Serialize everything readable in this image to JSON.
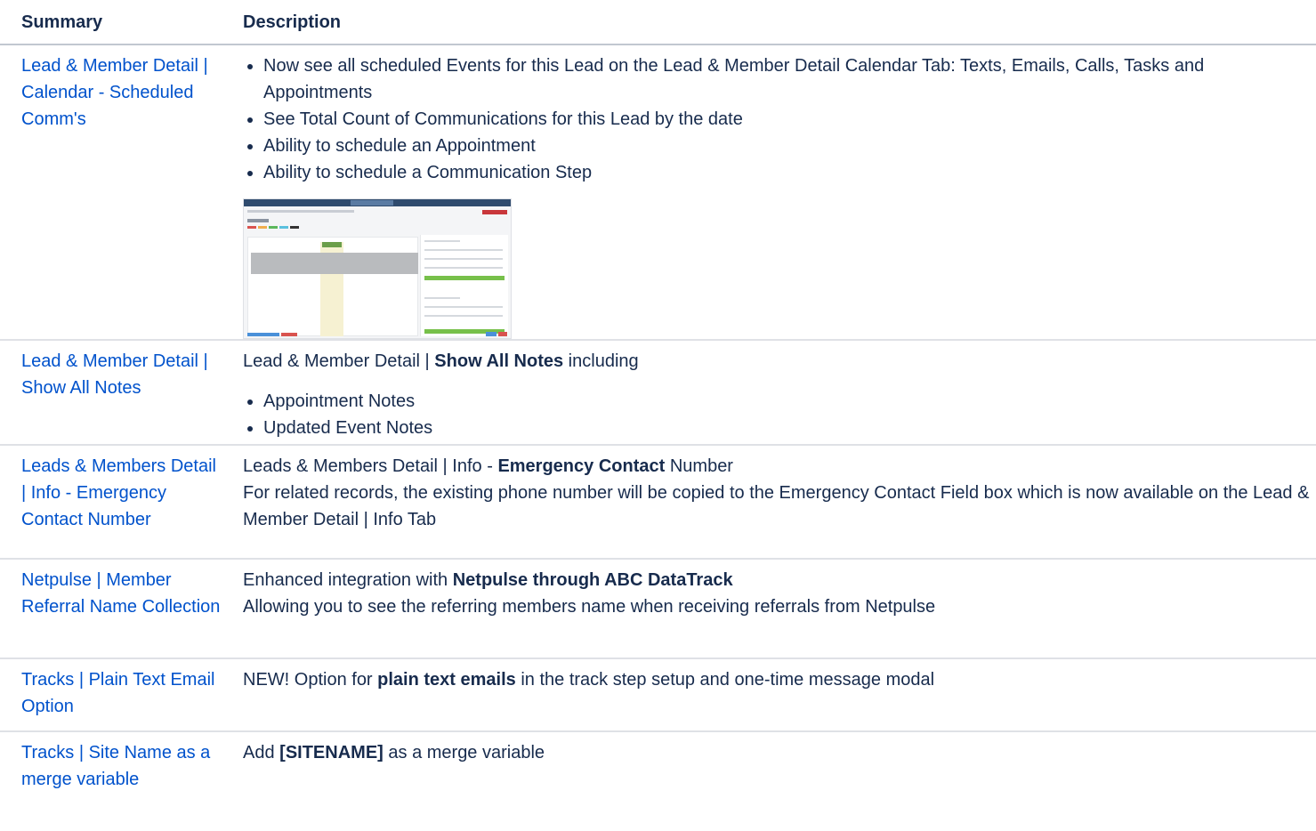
{
  "table": {
    "headers": {
      "summary": "Summary",
      "description": "Description"
    },
    "rows": [
      {
        "summary": "Lead & Member Detail | Calendar - Scheduled Comm's",
        "bullets": [
          "Now see all scheduled Events for this Lead on the Lead & Member Detail Calendar Tab: Texts, Emails, Calls, Tasks and Appointments",
          "See Total Count of Communications for this Lead by the date",
          "Ability to schedule an Appointment",
          "Ability to schedule a Communication Step"
        ]
      },
      {
        "summary": "Lead & Member Detail | Show All Notes",
        "intro_pre": "Lead & Member Detail | ",
        "intro_bold": "Show All Notes",
        "intro_post": " including",
        "bullets": [
          "Appointment Notes",
          "Updated Event Notes"
        ]
      },
      {
        "summary": "Leads & Members Detail | Info - Emergency Contact Number",
        "line1_pre": "Leads & Members Detail | Info - ",
        "line1_bold": "Emergency Contact",
        "line1_post": " Number",
        "line2": "For related records, the existing phone number will be copied to the Emergency Contact Field box which is now available on the Lead & Member Detail | Info Tab"
      },
      {
        "summary": "Netpulse | Member Referral Name Collection",
        "line1_pre": "Enhanced integration with ",
        "line1_bold": "Netpulse through ABC DataTrack",
        "line2": "Allowing you to see the referring members name when receiving referrals from Netpulse"
      },
      {
        "summary": "Tracks | Plain Text Email Option",
        "line1_pre": "NEW! Option for ",
        "line1_bold": "plain text emails",
        "line1_post": " in the track step setup and one-time message modal"
      },
      {
        "summary": "Tracks | Site Name as a merge variable",
        "line1_pre": "Add ",
        "line1_bold": "[SITENAME]",
        "line1_post": " as a merge variable"
      }
    ]
  },
  "colors": {
    "link": "#0052cc",
    "text": "#172b4d",
    "border": "#dfe1e6"
  }
}
